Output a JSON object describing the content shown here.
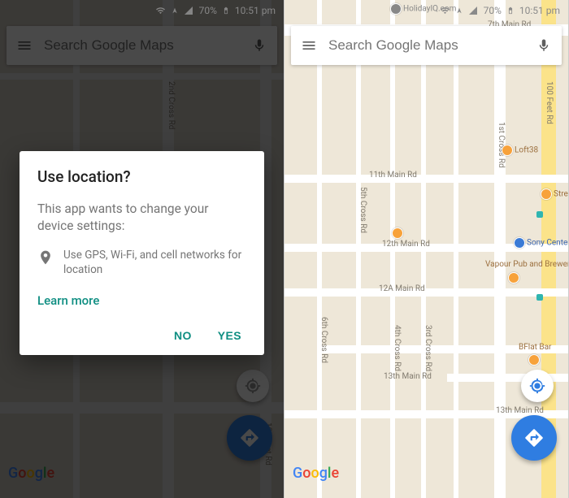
{
  "status": {
    "battery_pct": "70%",
    "time": "10:51 pm"
  },
  "search": {
    "placeholder": "Search Google Maps"
  },
  "logo": {
    "g": "G",
    "o1": "o",
    "o2": "o",
    "g2": "g",
    "l": "l",
    "e": "e"
  },
  "dialog": {
    "title": "Use location?",
    "body": "This app wants to change your device settings:",
    "item": "Use GPS, Wi-Fi, and cell networks for location",
    "learn": "Learn more",
    "no": "NO",
    "yes": "YES"
  },
  "left_map": {
    "label_2ndcross": "2nd Cross Rd",
    "label_100feet": "100 Feet Rd"
  },
  "right_map": {
    "roads": {
      "r_7thmain": "7th Main Rd",
      "r_11thmain": "11th Main Rd",
      "r_12thmain": "12th Main Rd",
      "r_12Amain": "12A Main Rd",
      "r_13thmain": "13th Main Rd",
      "r_13thmain2": "13th Main Rd",
      "r_100feet": "100 Feet Rd",
      "r_1stcross": "1st Cross Rd",
      "r_3rdcross": "3rd Cross Rd",
      "r_4thcross": "4th Cross Rd",
      "r_5thcross": "5th Cross Rd",
      "r_6thcross": "6th Cross Rd"
    },
    "pois": {
      "holidayiq": "HolidayIQ.com",
      "loft38": "Loft38",
      "streisan": "Streisan",
      "sony": "Sony Center",
      "vapour": "Vapour Pub and Brewery",
      "bflat": "BFlat Bar"
    }
  }
}
